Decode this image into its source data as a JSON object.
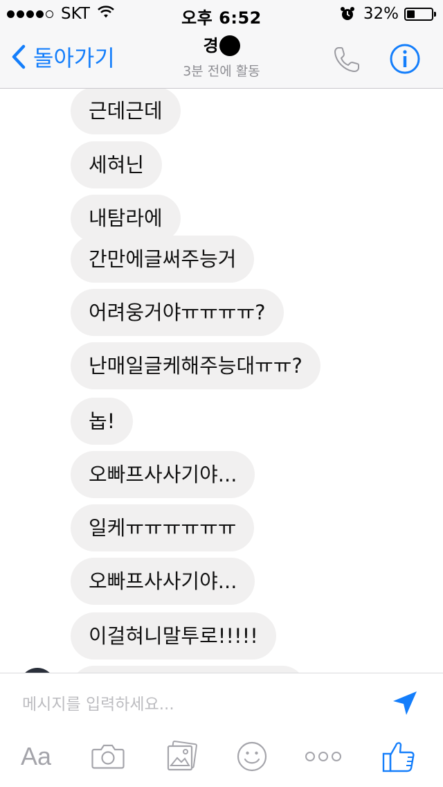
{
  "status_bar": {
    "carrier": "SKT",
    "time": "오후 6:52",
    "battery_percent": "32%",
    "battery_level": 0.32,
    "signal_bars_filled": 4,
    "signal_bars_total": 5
  },
  "header": {
    "back_label": "돌아가기",
    "contact_name": "경",
    "contact_status": "3분 전에 활동",
    "accent_color": "#147efb"
  },
  "messages": [
    {
      "text": "근데근데"
    },
    {
      "text": "세혀닌"
    },
    {
      "text": "내탐라에"
    },
    {
      "text": "간만에글써주능거"
    },
    {
      "text": "어려웅거야ㅠㅠㅠㅠ?"
    },
    {
      "text": "난매일글케해주능대ㅠㅠ?"
    },
    {
      "text": "놉!"
    },
    {
      "text": "오빠프사사기야..."
    },
    {
      "text": "일케ㅠㅠㅠㅠㅠㅠ"
    },
    {
      "text": "오빠프사사기야..."
    },
    {
      "text": "이걸혀니말투로!!!!!"
    }
  ],
  "composer": {
    "placeholder": "메시지를 입력하세요...",
    "text_format_label": "Aa",
    "icons": [
      "text-format-icon",
      "camera-icon",
      "photo-gallery-icon",
      "emoji-icon",
      "more-icon",
      "like-icon"
    ]
  }
}
